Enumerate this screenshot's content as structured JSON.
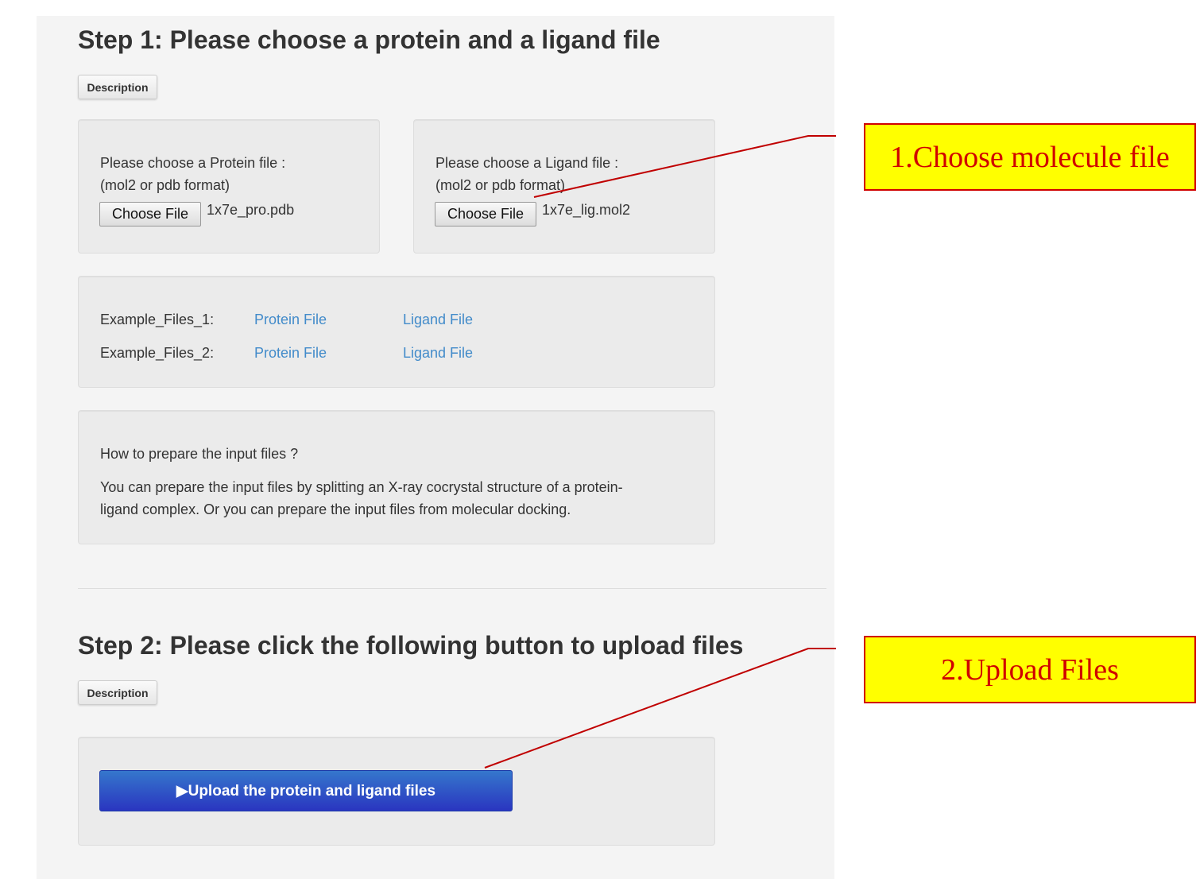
{
  "step1": {
    "title": "Step 1: Please choose a protein and a ligand file",
    "description_label": "Description",
    "protein": {
      "label": "Please choose a Protein file :",
      "format": "(mol2 or pdb format)",
      "button": "Choose File",
      "filename": "1x7e_pro.pdb"
    },
    "ligand": {
      "label": "Please choose a Ligand file :",
      "format": "(mol2 or pdb format)",
      "button": "Choose File",
      "filename": "1x7e_lig.mol2"
    },
    "examples": [
      {
        "label": "Example_Files_1:",
        "protein": "Protein File",
        "ligand": "Ligand File"
      },
      {
        "label": "Example_Files_2:",
        "protein": "Protein File",
        "ligand": "Ligand File"
      }
    ],
    "howto": {
      "title": "How to prepare the input files ?",
      "line1": "You can prepare the input files by splitting an X-ray cocrystal structure of a protein-",
      "line2": "ligand complex. Or you can prepare the input files from molecular docking."
    }
  },
  "step2": {
    "title": "Step 2: Please click the following button to upload files",
    "description_label": "Description",
    "upload_button": "Upload the protein and ligand files",
    "upload_icon": "play-triangle-icon"
  },
  "annotations": {
    "callout1": "1.Choose molecule file",
    "callout2": "2.Upload Files",
    "color": "#d00000",
    "bg": "#ffff00"
  }
}
